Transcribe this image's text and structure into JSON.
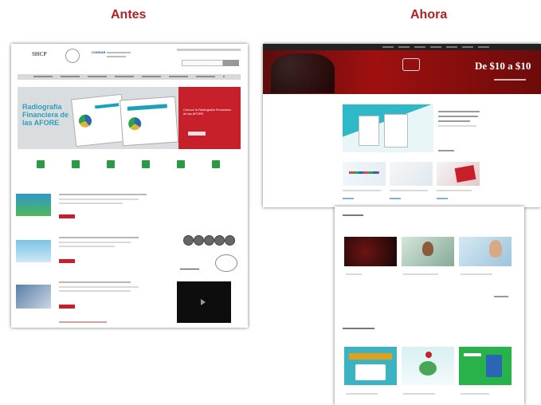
{
  "labels": {
    "before": "Antes",
    "now": "Ahora"
  },
  "old_site": {
    "header_logo": "SHCP",
    "agency_logo": "CONSAR",
    "banner_title": "Radiografía Financiera de las AFORE",
    "banner_side_text": "Conoce la Radiografía Financiera de las AFORE",
    "banner_button": "",
    "news": [
      {
        "title": "",
        "button": ""
      },
      {
        "title": "",
        "button": ""
      },
      {
        "title": "",
        "button": ""
      }
    ]
  },
  "new_site": {
    "hero_price": "De $10 a $10",
    "hero_sub": "",
    "sections": [
      "",
      ""
    ]
  },
  "colors": {
    "accent": "#b21f24",
    "green": "#2a9a44",
    "teal": "#25b7c5",
    "dark": "#1e1e1e"
  }
}
